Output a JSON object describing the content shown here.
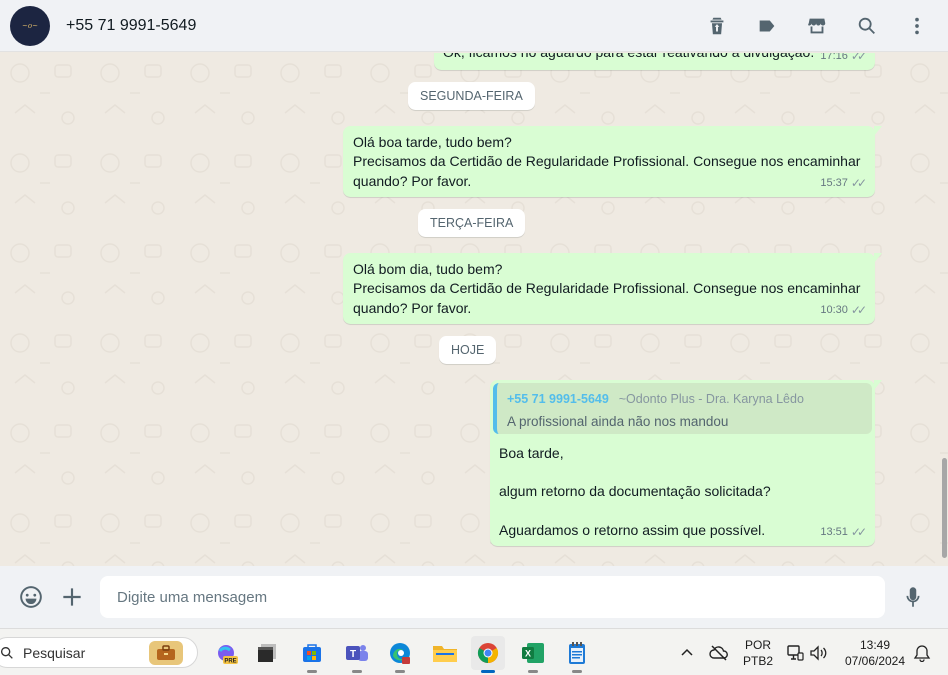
{
  "header": {
    "contact_name": "+55 71 9991-5649",
    "icons": [
      "delete-icon",
      "label-icon",
      "store-icon",
      "search-icon",
      "menu-icon"
    ]
  },
  "messages": [
    {
      "type": "out",
      "text": "Ok, ficamos no aguardo para estar reativando a divulgação.",
      "time": "17:16"
    },
    {
      "type": "day",
      "text": "SEGUNDA-FEIRA"
    },
    {
      "type": "out",
      "lines": [
        "Olá boa tarde, tudo bem?",
        "Precisamos da Certidão de Regularidade Profissional. Consegue nos encaminhar",
        "quando? Por favor."
      ],
      "time": "15:37"
    },
    {
      "type": "day",
      "text": "TERÇA-FEIRA"
    },
    {
      "type": "out",
      "lines": [
        "Olá bom dia, tudo bem?",
        "Precisamos da Certidão de Regularidade Profissional. Consegue nos encaminhar",
        "quando? Por favor."
      ],
      "time": "10:30"
    },
    {
      "type": "day",
      "text": "HOJE"
    },
    {
      "type": "out",
      "quote": {
        "sender": "+55 71 9991-5649",
        "sender_name": "~Odonto Plus - Dra. Karyna Lêdo",
        "text": "A profissional ainda não nos mandou"
      },
      "lines": [
        "Boa tarde,",
        "algum retorno da documentação solicitada?",
        "Aguardamos o retorno assim que possível."
      ],
      "time": "13:51"
    }
  ],
  "composer": {
    "placeholder": "Digite uma mensagem",
    "icons": [
      "emoji-icon",
      "plus-icon",
      "mic-icon"
    ]
  },
  "taskbar": {
    "search_label": "Pesquisar",
    "apps": [
      "briefcase-icon",
      "copilot-pre-icon",
      "window-icon",
      "store-icon",
      "teams-icon",
      "edge-icon",
      "folder-icon",
      "chrome-icon",
      "excel-icon",
      "notepad-icon"
    ],
    "lang_top": "POR",
    "lang_bottom": "PTB2",
    "time": "13:49",
    "date": "07/06/2024"
  }
}
